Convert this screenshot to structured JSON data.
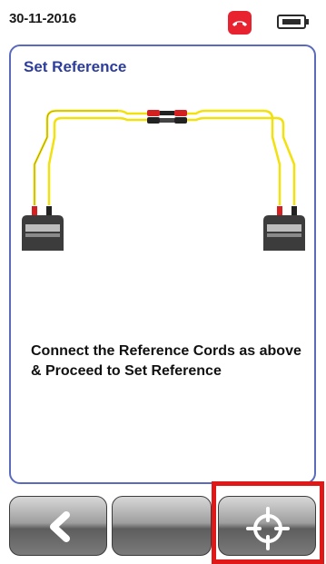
{
  "status_bar": {
    "date": "30-11-2016",
    "phone_icon": "phone-hangup-icon",
    "battery_icon": "battery-icon"
  },
  "screen": {
    "title": "Set Reference",
    "instruction": "Connect the Reference Cords as above & Proceed to Set Reference",
    "diagram": {
      "cable_color": "#f2e10c",
      "connector_red": "#d42020",
      "device_color": "#3c3c3c"
    }
  },
  "softkeys": {
    "back_icon": "chevron-left-icon",
    "middle_icon": "",
    "right_icon": "crosshair-icon"
  },
  "colors": {
    "title": "#2d3d9b",
    "panel_border": "#5a6abc",
    "highlight": "#e01818"
  }
}
